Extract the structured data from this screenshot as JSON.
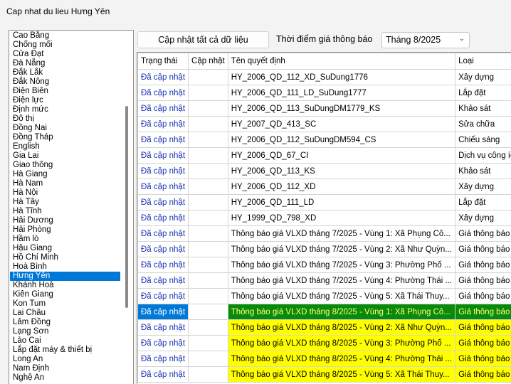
{
  "window": {
    "title": "Cap nhat du lieu Hưng Yên"
  },
  "provinces": [
    "Cao Bằng",
    "Chống mối",
    "Cửa Đạt",
    "Đà Nẵng",
    "Đắk Lắk",
    "Đắk Nông",
    "Điện Biên",
    "Điện lực",
    "Định mức",
    "Đô thị",
    "Đồng Nai",
    "Đồng Tháp",
    "English",
    "Gia Lai",
    "Giao thông",
    "Hà Giang",
    "Hà Nam",
    "Hà Nội",
    "Hà Tây",
    "Hà Tĩnh",
    "Hải Dương",
    "Hải Phòng",
    "Hầm lò",
    "Hậu Giang",
    "Hồ Chí Minh",
    "Hoà Bình",
    "Hưng Yên",
    "Khánh Hoà",
    "Kiên Giang",
    "Kon Tum",
    "Lai Châu",
    "Lâm Đồng",
    "Lạng Sơn",
    "Lào Cai",
    "Lắp đặt máy & thiết bị",
    "Long An",
    "Nam Định",
    "Nghệ An"
  ],
  "selected_province": "Hưng Yên",
  "toolbar": {
    "update_all_label": "Cập nhật tất cả dữ liệu",
    "time_label": "Thời điểm giá thông báo",
    "time_value": "Tháng 8/2025"
  },
  "grid": {
    "columns": [
      "Trạng thái",
      "Cập nhật",
      "Tên quyết định",
      "Loại"
    ],
    "rows": [
      {
        "status": "Đã cập nhật",
        "update": "",
        "name": "HY_2006_QD_112_XD_SuDung1776",
        "type": "Xây dựng",
        "style": ""
      },
      {
        "status": "Đã cập nhật",
        "update": "",
        "name": "HY_2006_QD_111_LD_SuDung1777",
        "type": "Lắp đặt",
        "style": ""
      },
      {
        "status": "Đã cập nhật",
        "update": "",
        "name": "HY_2006_QD_113_SuDungDM1779_KS",
        "type": "Khảo sát",
        "style": ""
      },
      {
        "status": "Đã cập nhật",
        "update": "",
        "name": "HY_2007_QD_413_SC",
        "type": "Sửa chữa",
        "style": ""
      },
      {
        "status": "Đã cập nhật",
        "update": "",
        "name": "HY_2006_QD_112_SuDungDM594_CS",
        "type": "Chiếu sáng",
        "style": ""
      },
      {
        "status": "Đã cập nhật",
        "update": "",
        "name": "HY_2006_QD_67_CI",
        "type": "Dịch vụ công ích",
        "style": ""
      },
      {
        "status": "Đã cập nhật",
        "update": "",
        "name": "HY_2006_QD_113_KS",
        "type": "Khảo sát",
        "style": ""
      },
      {
        "status": "Đã cập nhật",
        "update": "",
        "name": "HY_2006_QD_112_XD",
        "type": "Xây dựng",
        "style": ""
      },
      {
        "status": "Đã cập nhật",
        "update": "",
        "name": "HY_2006_QD_111_LD",
        "type": "Lắp đặt",
        "style": ""
      },
      {
        "status": "Đã cập nhật",
        "update": "",
        "name": "HY_1999_QD_798_XD",
        "type": "Xây dựng",
        "style": ""
      },
      {
        "status": "Đã cập nhật",
        "update": "",
        "name": "Thông báo giá VLXD tháng 7/2025 - Vùng 1: Xã Phụng Cô...",
        "type": "Giá thông báo",
        "style": ""
      },
      {
        "status": "Đã cập nhật",
        "update": "",
        "name": "Thông báo giá VLXD tháng 7/2025 - Vùng 2: Xã Như Quỳn...",
        "type": "Giá thông báo",
        "style": ""
      },
      {
        "status": "Đã cập nhật",
        "update": "",
        "name": "Thông báo giá VLXD tháng 7/2025 - Vùng 3: Phường Phố ...",
        "type": "Giá thông báo",
        "style": ""
      },
      {
        "status": "Đã cập nhật",
        "update": "",
        "name": "Thông báo giá VLXD tháng 7/2025 - Vùng 4: Phường Thái ...",
        "type": "Giá thông báo",
        "style": ""
      },
      {
        "status": "Đã cập nhật",
        "update": "",
        "name": "Thông báo giá VLXD tháng 7/2025 - Vùng 5: Xã Thái Thuy...",
        "type": "Giá thông báo",
        "style": ""
      },
      {
        "status": "Đã cập nhật",
        "update": "",
        "name": "Thông báo giá VLXD tháng 8/2025 - Vùng 1: Xã Phụng Cô...",
        "type": "Giá thông báo",
        "style": "selected"
      },
      {
        "status": "Đã cập nhật",
        "update": "",
        "name": "Thông báo giá VLXD tháng 8/2025 - Vùng 2: Xã Như Quỳn...",
        "type": "Giá thông báo",
        "style": "hl"
      },
      {
        "status": "Đã cập nhật",
        "update": "",
        "name": "Thông báo giá VLXD tháng 8/2025 - Vùng 3: Phường Phố ...",
        "type": "Giá thông báo",
        "style": "hl"
      },
      {
        "status": "Đã cập nhật",
        "update": "",
        "name": "Thông báo giá VLXD tháng 8/2025 - Vùng 4: Phường Thái ...",
        "type": "Giá thông báo",
        "style": "hl"
      },
      {
        "status": "Đã cập nhật",
        "update": "",
        "name": "Thông báo giá VLXD tháng 8/2025 - Vùng 5: Xã Thái Thuy...",
        "type": "Giá thông báo",
        "style": "hl"
      }
    ]
  }
}
